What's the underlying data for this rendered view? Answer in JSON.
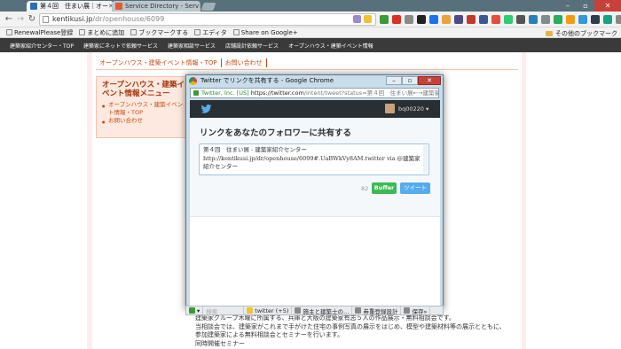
{
  "browser": {
    "tabs": [
      {
        "label": "第４回　住まい展｜オー",
        "active": true
      },
      {
        "label": "Service Directory - Serv",
        "active": false
      }
    ],
    "url_host": "kentikusi.jp",
    "url_path": "/dr/openhouse/6099",
    "bookmarks": [
      "RenewalPlease登録",
      "まとめに追加",
      "ブックマークする",
      "エディタ",
      "Share on Google+"
    ],
    "other_bookmarks": "その他のブックマーク"
  },
  "site": {
    "nav": [
      "建築家紹介センター・TOP",
      "建築家にネットで依頼サービス",
      "建築家相談サービス",
      "店舗設計依頼サービス",
      "オープンハウス・建築イベント情報"
    ],
    "subnav": [
      "オープンハウス・建築イベント情報・TOP",
      "お問い合わせ"
    ],
    "sidebar_title": "オープンハウス・建築イベント情報メニュー",
    "sidebar_items": [
      "オープンハウス・建築イベント情報・TOP",
      "お問い合わせ"
    ],
    "body_lines": [
      "建築家グループ木曜に所属する、兵庫と大阪の建築家有志５人の作品展示・無料相談会です。",
      "当相談会では、建築家がこれまで手がけた住宅の事例写真の展示をはじめ、模型や建築材料等の展示とともに、",
      "参加建築家による無料相談会とセミナーを行います。",
      "同時開催セミナー"
    ]
  },
  "popup": {
    "title": "Twitter でリンクを共有する - Google Chrome",
    "url_secure": "Twitter, Inc. [US]",
    "url_host": "https://twitter.com",
    "url_rest": "/intent/tweet?status=第４回　住まい展←→建築家紹",
    "username": "bq00220 ▾",
    "heading": "リンクをあなたのフォロワーに共有する",
    "tweet_text": "第４回　住まい展 - 建築家紹介センター http://kentikusi.jp/dr/openhouse/6099#.UaBWkVy8AM.twitter via @建築家紹介センター",
    "char_count": "82",
    "buffer_label": "Buffer",
    "tweet_label": "ツイート"
  },
  "toolbar": {
    "items": [
      "twitter (+5)",
      "施主と建築士の…",
      "券重登録設計",
      "保存»"
    ],
    "field_placeholder": "検索"
  },
  "colors": {
    "accent_orange": "#c64b12",
    "twitter_blue": "#55acee",
    "buffer_green": "#3cba54"
  }
}
